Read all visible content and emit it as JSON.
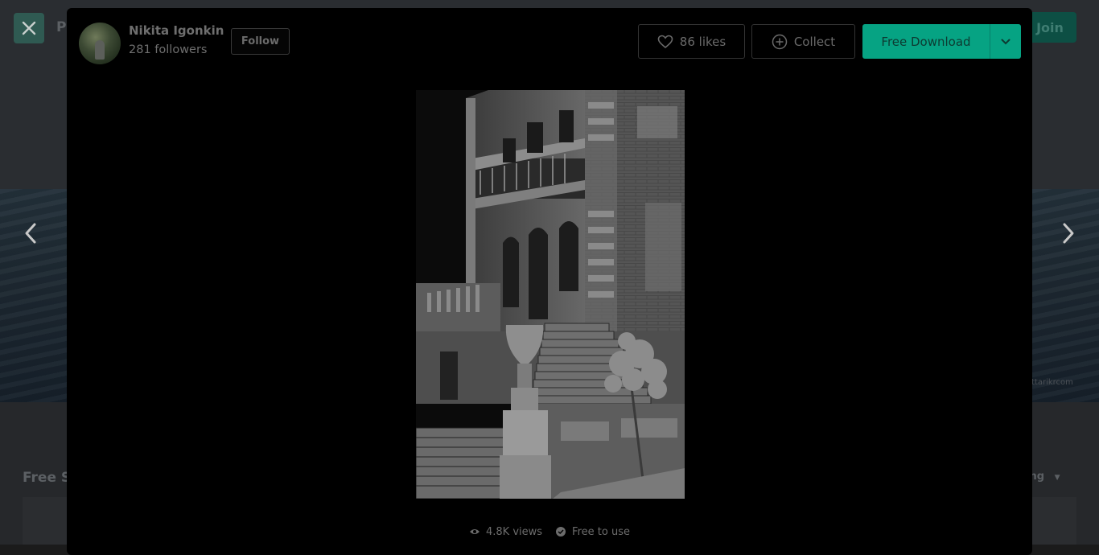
{
  "background": {
    "nav_partial": "P",
    "join_label": "Join",
    "section_partial": "Free S",
    "sort_partial": "ing",
    "credit_partial": "ttarikrcom"
  },
  "author": {
    "name": "Nikita Igonkin",
    "followers": "281 followers",
    "follow_label": "Follow"
  },
  "actions": {
    "likes_label": "86 likes",
    "collect_label": "Collect",
    "download_label": "Free Download"
  },
  "stats": {
    "views": "4.8K views",
    "license": "Free to use"
  },
  "colors": {
    "accent": "#06a383",
    "modal_bg": "#000000"
  },
  "icons": [
    "close-icon",
    "chevron-left-icon",
    "chevron-right-icon",
    "heart-icon",
    "plus-circle-icon",
    "chevron-down-icon",
    "eye-icon",
    "check-circle-icon"
  ]
}
